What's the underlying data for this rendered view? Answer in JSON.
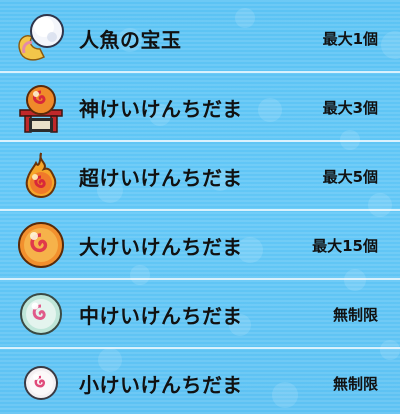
{
  "items": [
    {
      "name": "人魚の宝玉",
      "limit": "最大1個",
      "icon": "mermaid-jewel-icon"
    },
    {
      "name": "神けいけんちだま",
      "limit": "最大3個",
      "icon": "god-exp-orb-icon"
    },
    {
      "name": "超けいけんちだま",
      "limit": "最大5個",
      "icon": "super-exp-orb-icon"
    },
    {
      "name": "大けいけんちだま",
      "limit": "最大15個",
      "icon": "large-exp-orb-icon"
    },
    {
      "name": "中けいけんちだま",
      "limit": "無制限",
      "icon": "medium-exp-orb-icon"
    },
    {
      "name": "小けいけんちだま",
      "limit": "無制限",
      "icon": "small-exp-orb-icon"
    }
  ],
  "colors": {
    "background": "#5ec3f4",
    "divider": "#ffffff",
    "text": "#111111"
  }
}
